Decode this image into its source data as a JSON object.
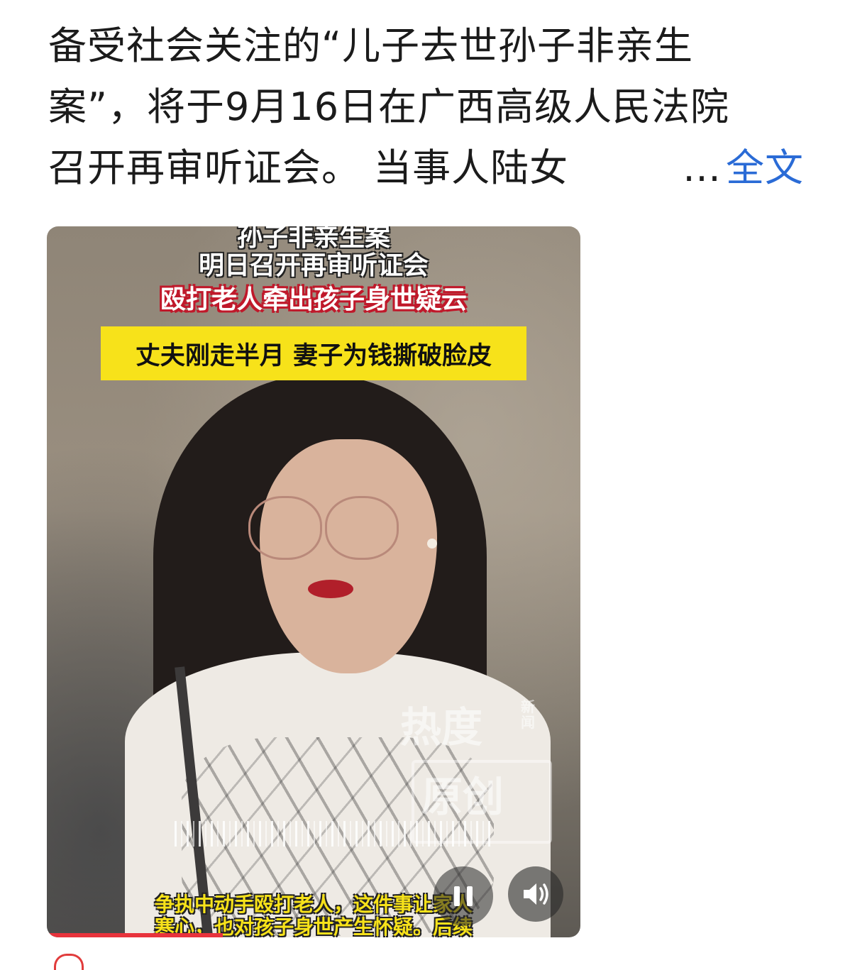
{
  "post": {
    "line1": "备受社会关注的“儿子去世孙子非亲生",
    "line2": "案”，将于9月16日在广西高级人民法院",
    "line3": "召开再审听证会。 当事人陆女",
    "ellipsis": "…",
    "expand_label": "全文"
  },
  "video": {
    "caption_top_1": "孙子非亲生案",
    "caption_top_2": "明日召开再审听证会",
    "caption_top_3": "殴打老人牵出孩子身世疑云",
    "banner": "丈夫刚走半月 妻子为钱撕破脸皮",
    "watermark_line1": "热度",
    "watermark_small": "新闻",
    "watermark_line2": "原创",
    "subtitle_1": "争执中动手殴打老人，这件事让家人",
    "subtitle_2": "寒心，也对孩子身世产生怀疑。后续",
    "progress_fraction": 0.33
  },
  "icons": {
    "pause": "pause-icon",
    "volume": "speaker-icon"
  },
  "colors": {
    "link": "#2a6bd6",
    "banner": "#f7e21a",
    "progress": "#e8333c"
  }
}
